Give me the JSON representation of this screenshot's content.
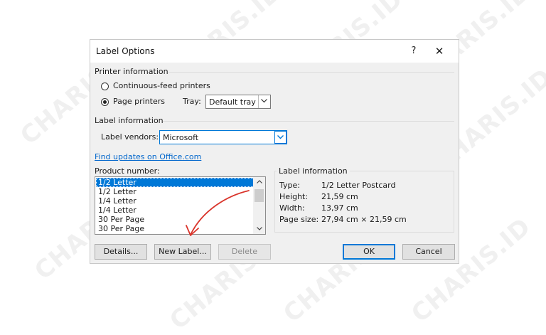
{
  "window": {
    "title": "Label Options",
    "help_glyph": "?",
    "close_glyph": "✕"
  },
  "printer_info": {
    "heading": "Printer information",
    "continuous": {
      "label": "Continuous-feed printers",
      "checked": false
    },
    "page": {
      "label": "Page printers",
      "checked": true
    },
    "tray": {
      "label": "Tray:",
      "value": "Default tray"
    }
  },
  "label_info": {
    "heading": "Label information",
    "vendor_label": "Label vendors:",
    "vendor_value": "Microsoft",
    "updates_link": "Find updates on Office.com",
    "product_number_label": "Product number:",
    "products": [
      "1/2 Letter",
      "1/2 Letter",
      "1/4 Letter",
      "1/4 Letter",
      "30 Per Page",
      "30 Per Page"
    ],
    "selected_index": 0
  },
  "details": {
    "heading": "Label information",
    "type": {
      "key": "Type:",
      "value": "1/2 Letter Postcard"
    },
    "height": {
      "key": "Height:",
      "value": "21,59 cm"
    },
    "width": {
      "key": "Width:",
      "value": "13,97 cm"
    },
    "page_size": {
      "key": "Page size:",
      "value": "27,94 cm × 21,59 cm"
    }
  },
  "buttons": {
    "details": "Details...",
    "new_label": "New Label...",
    "delete": "Delete",
    "ok": "OK",
    "cancel": "Cancel"
  },
  "watermark": "CHARIS.ID",
  "colors": {
    "accent": "#0078d7",
    "link": "#0066cc",
    "annotation_arrow": "#d9342b"
  },
  "icons": [
    "chevron-down-icon",
    "scroll-up-icon",
    "scroll-down-icon",
    "close-icon",
    "help-icon"
  ]
}
